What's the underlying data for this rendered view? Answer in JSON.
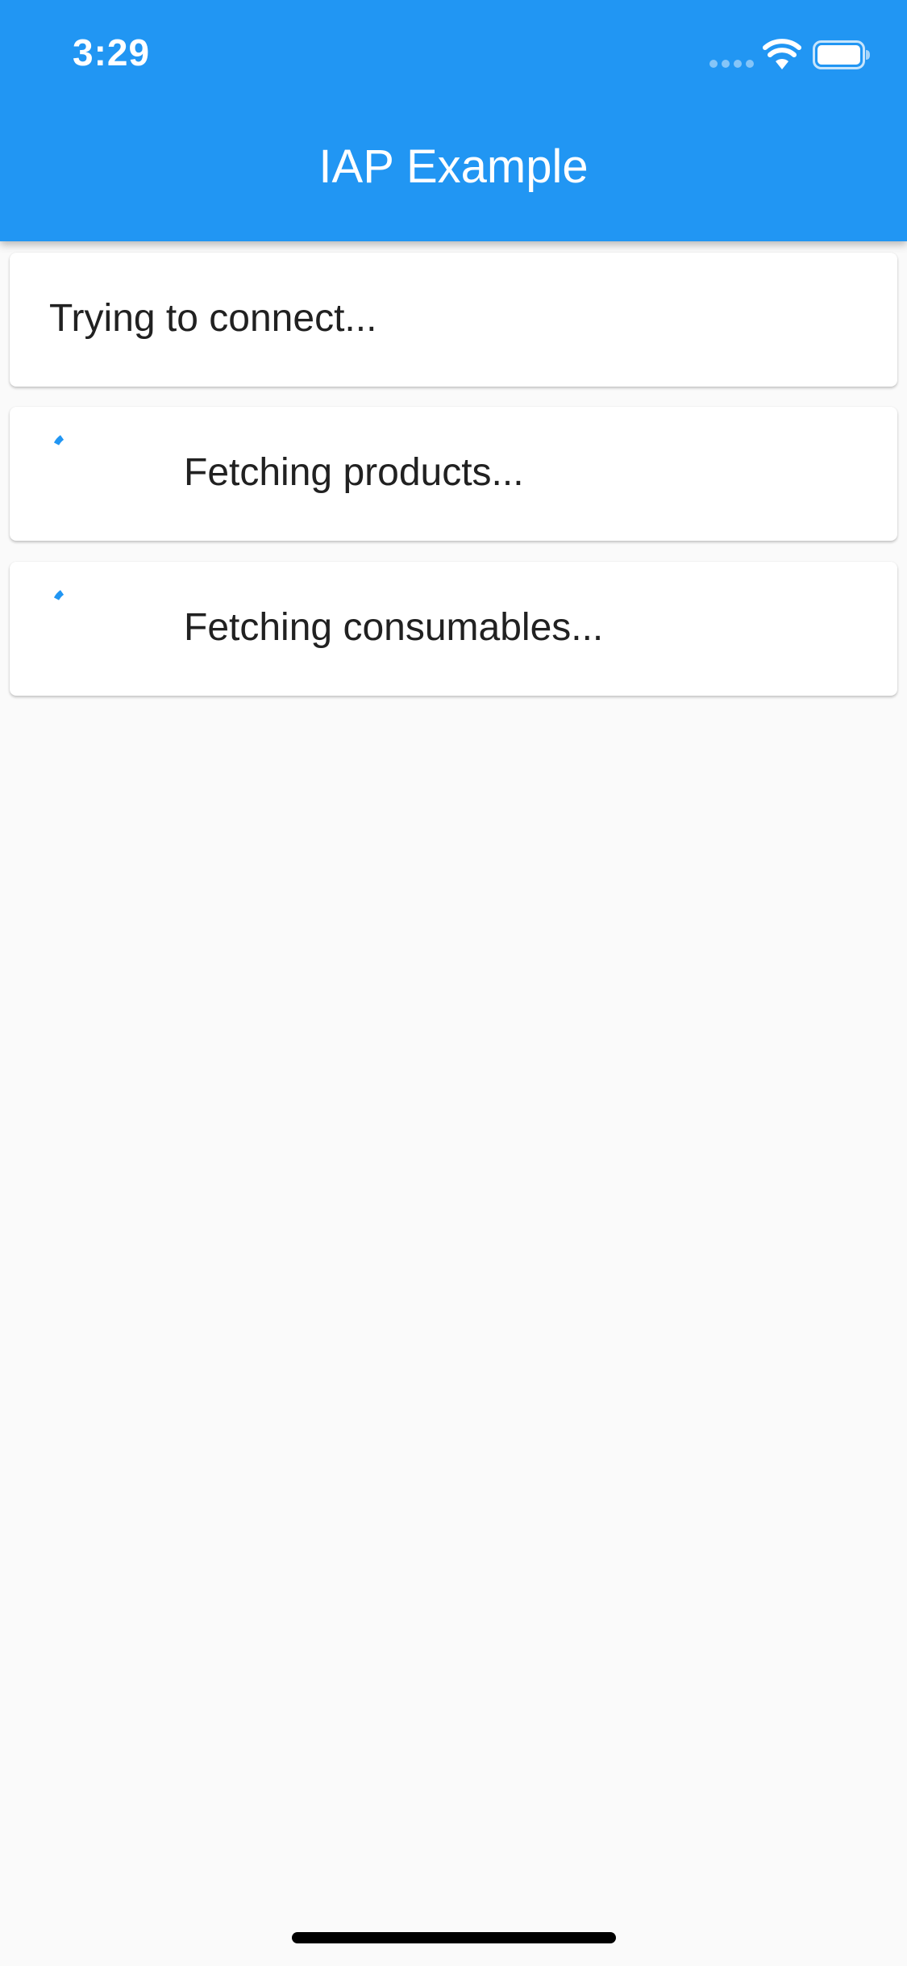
{
  "status_bar": {
    "time": "3:29",
    "icons": [
      "cellular-signal-icon",
      "wifi-icon",
      "battery-icon"
    ]
  },
  "app_bar": {
    "title": "IAP Example",
    "color": "#2196f3"
  },
  "cards": [
    {
      "text": "Trying to connect...",
      "loading": false
    },
    {
      "text": "Fetching products...",
      "loading": true
    },
    {
      "text": "Fetching consumables...",
      "loading": true
    }
  ],
  "colors": {
    "accent": "#2196f3",
    "background": "#fafafa",
    "card": "#ffffff",
    "text": "#212121"
  }
}
